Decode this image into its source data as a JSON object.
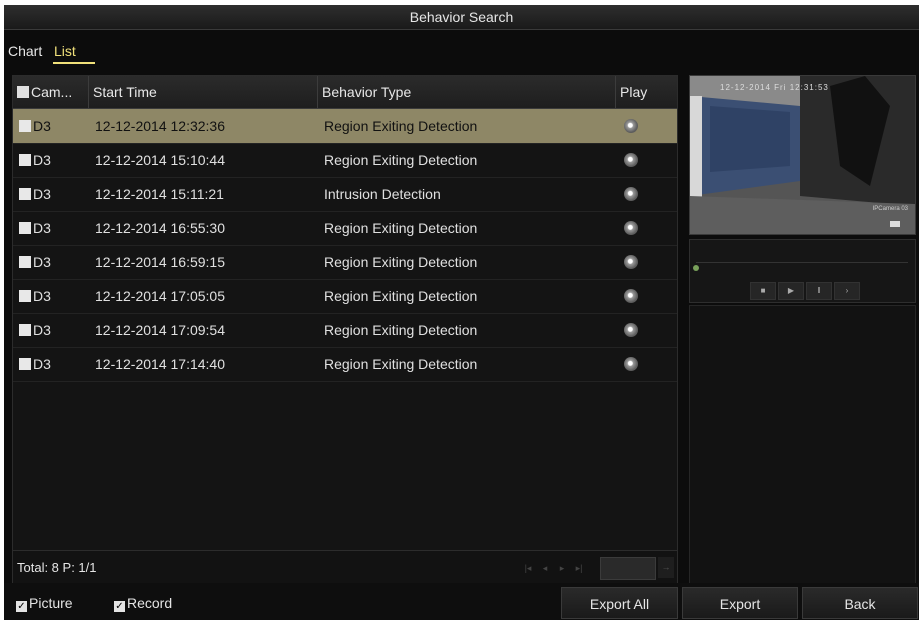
{
  "window": {
    "title": "Behavior Search"
  },
  "tabs": [
    {
      "label": "Chart",
      "active": false
    },
    {
      "label": "List",
      "active": true
    }
  ],
  "table": {
    "columns": [
      "Cam...",
      "Start Time",
      "Behavior Type",
      "Play"
    ],
    "rows": [
      {
        "camera": "D3",
        "start_time": "12-12-2014 12:32:36",
        "behavior_type": "Region Exiting Detection",
        "selected": true
      },
      {
        "camera": "D3",
        "start_time": "12-12-2014 15:10:44",
        "behavior_type": "Region Exiting Detection"
      },
      {
        "camera": "D3",
        "start_time": "12-12-2014 15:11:21",
        "behavior_type": "Intrusion Detection"
      },
      {
        "camera": "D3",
        "start_time": "12-12-2014 16:55:30",
        "behavior_type": "Region Exiting Detection"
      },
      {
        "camera": "D3",
        "start_time": "12-12-2014 16:59:15",
        "behavior_type": "Region Exiting Detection"
      },
      {
        "camera": "D3",
        "start_time": "12-12-2014 17:05:05",
        "behavior_type": "Region Exiting Detection"
      },
      {
        "camera": "D3",
        "start_time": "12-12-2014 17:09:54",
        "behavior_type": "Region Exiting Detection"
      },
      {
        "camera": "D3",
        "start_time": "12-12-2014 17:14:40",
        "behavior_type": "Region Exiting Detection"
      }
    ]
  },
  "pagination": {
    "summary": "Total: 8  P: 1/1"
  },
  "preview": {
    "timestamp": "12-12-2014 Fri 12:31:53",
    "camera_label": "IPCamera 03"
  },
  "options": {
    "picture_label": "Picture",
    "picture_checked": true,
    "record_label": "Record",
    "record_checked": true
  },
  "buttons": {
    "export_all": "Export All",
    "export": "Export",
    "back": "Back"
  },
  "colors": {
    "selected_row": "#8e8766",
    "active_tab": "#f0e07a"
  }
}
